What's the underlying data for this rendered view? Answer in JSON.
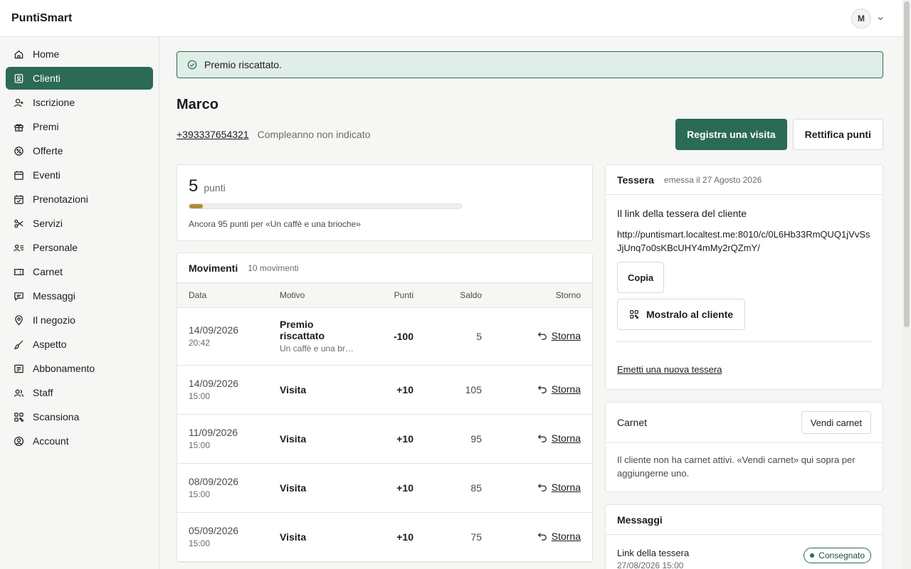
{
  "app": {
    "brand": "PuntiSmart",
    "user_initial": "M"
  },
  "sidebar": {
    "items": [
      {
        "label": "Home",
        "icon": "home-icon"
      },
      {
        "label": "Clienti",
        "icon": "contacts-icon",
        "active": true
      },
      {
        "label": "Iscrizione",
        "icon": "user-plus-icon"
      },
      {
        "label": "Premi",
        "icon": "gift-icon"
      },
      {
        "label": "Offerte",
        "icon": "discount-icon"
      },
      {
        "label": "Eventi",
        "icon": "calendar-icon"
      },
      {
        "label": "Prenotazioni",
        "icon": "calendar-check-icon"
      },
      {
        "label": "Servizi",
        "icon": "scissors-icon"
      },
      {
        "label": "Personale",
        "icon": "team-icon"
      },
      {
        "label": "Carnet",
        "icon": "ticket-icon"
      },
      {
        "label": "Messaggi",
        "icon": "message-icon"
      },
      {
        "label": "Il negozio",
        "icon": "location-pin-icon"
      },
      {
        "label": "Aspetto",
        "icon": "brush-icon"
      },
      {
        "label": "Abbonamento",
        "icon": "receipt-icon"
      },
      {
        "label": "Staff",
        "icon": "users-icon"
      },
      {
        "label": "Scansiona",
        "icon": "qr-icon"
      },
      {
        "label": "Account",
        "icon": "account-icon"
      }
    ]
  },
  "alert": {
    "text": "Premio riscattato."
  },
  "customer": {
    "name": "Marco",
    "phone": "+393337654321",
    "birthday": "Compleanno non indicato"
  },
  "actions": {
    "register_visit": "Registra una visita",
    "adjust_points": "Rettifica punti"
  },
  "points": {
    "value": "5",
    "unit": "punti",
    "progress_fraction": 0.05,
    "note": "Ancora 95 punti per «Un caffè e una brioche»"
  },
  "movements": {
    "title": "Movimenti",
    "count": "10 movimenti",
    "columns": {
      "date": "Data",
      "reason": "Motivo",
      "points": "Punti",
      "balance": "Saldo",
      "reversal": "Storno"
    },
    "rows": [
      {
        "date": "14/09/2026",
        "time": "20:42",
        "reason": "Premio riscattato",
        "reason_sub": "Un caffè e una br…",
        "points": "-100",
        "balance": "5",
        "action": "Storna"
      },
      {
        "date": "14/09/2026",
        "time": "15:00",
        "reason": "Visita",
        "reason_sub": "",
        "points": "+10",
        "balance": "105",
        "action": "Storna"
      },
      {
        "date": "11/09/2026",
        "time": "15:00",
        "reason": "Visita",
        "reason_sub": "",
        "points": "+10",
        "balance": "95",
        "action": "Storna"
      },
      {
        "date": "08/09/2026",
        "time": "15:00",
        "reason": "Visita",
        "reason_sub": "",
        "points": "+10",
        "balance": "85",
        "action": "Storna"
      },
      {
        "date": "05/09/2026",
        "time": "15:00",
        "reason": "Visita",
        "reason_sub": "",
        "points": "+10",
        "balance": "75",
        "action": "Storna"
      }
    ]
  },
  "card": {
    "title": "Tessera",
    "issued": "emessa il 27 Agosto 2026",
    "label": "Il link della tessera del cliente",
    "url": "http://puntismart.localtest.me:8010/c/0L6Hb33RmQUQ1jVvSsJjUnq7o0sKBcUHY4mMy2rQZmY/",
    "copy": "Copia",
    "show": "Mostralo al cliente",
    "new_card": "Emetti una nuova tessera"
  },
  "carnet": {
    "title": "Carnet",
    "sell": "Vendi carnet",
    "empty": "Il cliente non ha carnet attivi. «Vendi carnet» qui sopra per aggiungerne uno."
  },
  "messages": {
    "title": "Messaggi",
    "item_title": "Link della tessera",
    "item_time": "27/08/2026 15:00",
    "status": "Consegnato"
  },
  "colors": {
    "accent": "#2b6a55",
    "progress": "#b38a3a",
    "alert_bg": "#dfeee6"
  }
}
